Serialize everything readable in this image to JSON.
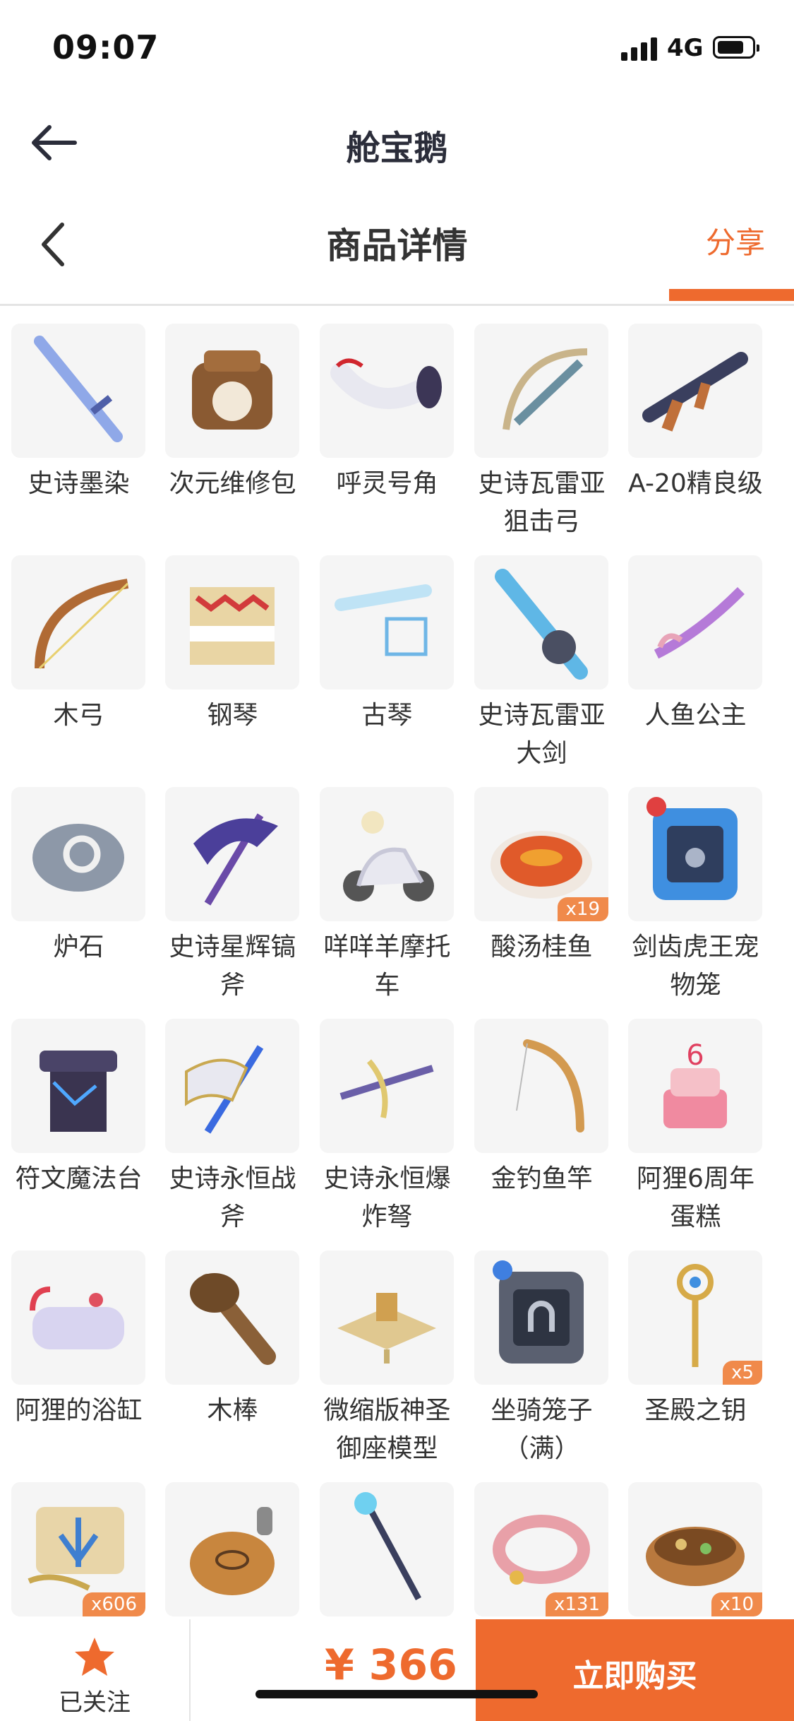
{
  "status": {
    "time": "09:07",
    "network": "4G"
  },
  "app_header": {
    "title": "舱宝鹅"
  },
  "page_header": {
    "title": "商品详情",
    "share": "分享"
  },
  "items": [
    {
      "name": "史诗墨染",
      "icon": "blue-sword-icon"
    },
    {
      "name": "次元维修包",
      "icon": "repair-bag-icon"
    },
    {
      "name": "呼灵号角",
      "icon": "horn-icon"
    },
    {
      "name": "史诗瓦雷亚狙击弓",
      "icon": "sniper-bow-icon"
    },
    {
      "name": "A-20精良级",
      "icon": "rifle-icon"
    },
    {
      "name": "木弓",
      "icon": "wooden-bow-icon"
    },
    {
      "name": "钢琴",
      "icon": "piano-icon"
    },
    {
      "name": "古琴",
      "icon": "guqin-icon"
    },
    {
      "name": "史诗瓦雷亚大剑",
      "icon": "greatsword-icon"
    },
    {
      "name": "人鱼公主",
      "icon": "mermaid-weapon-icon"
    },
    {
      "name": "炉石",
      "icon": "hearthstone-icon"
    },
    {
      "name": "史诗星辉镐斧",
      "icon": "pickaxe-icon"
    },
    {
      "name": "咩咩羊摩托车",
      "icon": "scooter-icon"
    },
    {
      "name": "酸汤桂鱼",
      "icon": "fish-soup-icon",
      "qty": "x19"
    },
    {
      "name": "剑齿虎王宠物笼",
      "icon": "pet-cage-icon"
    },
    {
      "name": "符文魔法台",
      "icon": "rune-table-icon"
    },
    {
      "name": "史诗永恒战斧",
      "icon": "battle-axe-icon"
    },
    {
      "name": "史诗永恒爆炸弩",
      "icon": "crossbow-icon"
    },
    {
      "name": "金钓鱼竿",
      "icon": "fishing-rod-icon"
    },
    {
      "name": "阿狸6周年蛋糕",
      "icon": "cake-icon"
    },
    {
      "name": "阿狸的浴缸",
      "icon": "bathtub-icon"
    },
    {
      "name": "木棒",
      "icon": "club-icon"
    },
    {
      "name": "微缩版神圣御座模型",
      "icon": "throne-model-icon"
    },
    {
      "name": "坐骑笼子（满）",
      "icon": "mount-cage-icon"
    },
    {
      "name": "圣殿之钥",
      "icon": "key-icon",
      "qty": "x5"
    },
    {
      "name": "",
      "icon": "scroll-icon",
      "qty": "x606"
    },
    {
      "name": "",
      "icon": "flask-icon"
    },
    {
      "name": "",
      "icon": "staff-icon"
    },
    {
      "name": "",
      "icon": "collar-icon",
      "qty": "x131"
    },
    {
      "name": "",
      "icon": "stew-bowl-icon",
      "qty": "x10"
    }
  ],
  "bottom_bar": {
    "follow_label": "已关注",
    "price": "¥ 366",
    "buy_label": "立即购买"
  },
  "colors": {
    "accent": "#ee6a2e",
    "tile_bg": "#f5f5f5",
    "badge": "#f08a4b"
  }
}
